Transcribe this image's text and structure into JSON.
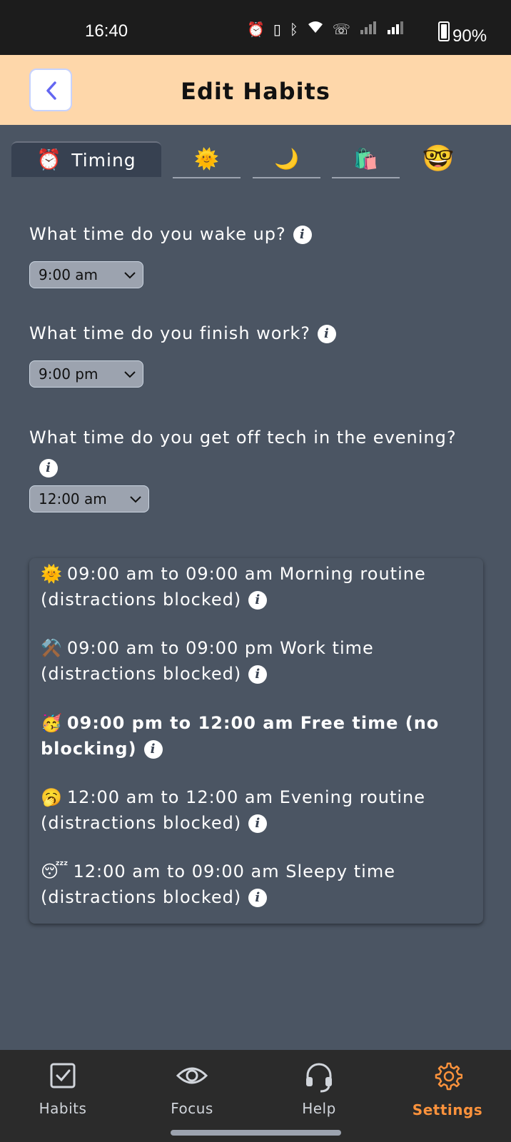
{
  "status_bar": {
    "time": "16:40",
    "battery": "90%",
    "icons": [
      "alarm-icon",
      "vibrate-icon",
      "bluetooth-icon",
      "wifi-icon",
      "wifi-calling-icon",
      "signal-1-icon",
      "signal-2-icon",
      "battery-icon"
    ]
  },
  "header": {
    "title": "Edit Habits",
    "back_icon": "chevron-left-icon"
  },
  "tabs": [
    {
      "emoji": "⏰",
      "label": "Timing",
      "active": true
    },
    {
      "emoji": "🌞",
      "label": "",
      "active": false
    },
    {
      "emoji": "🌙",
      "label": "",
      "active": false
    },
    {
      "emoji": "🛍️",
      "label": "",
      "active": false
    },
    {
      "emoji": "🤓",
      "label": "",
      "active": false
    }
  ],
  "questions": [
    {
      "text": "What time do you wake up?",
      "value": "9:00 am"
    },
    {
      "text": "What time do you finish work?",
      "value": "9:00 pm"
    },
    {
      "text": "What time do you get off tech in the evening?",
      "value": "12:00 am"
    }
  ],
  "schedule": [
    {
      "emoji": "🌞",
      "line1": "09:00 am to 09:00 am Morning routine",
      "line2": "(distractions blocked)",
      "bold": false
    },
    {
      "emoji": "⚒️",
      "line1": "09:00 am to 09:00 pm Work time",
      "line2": "(distractions blocked)",
      "bold": false
    },
    {
      "emoji": "🥳",
      "line1": "09:00 pm to 12:00 am Free time (no",
      "line2": "blocking)",
      "bold": true
    },
    {
      "emoji": "🥱",
      "line1": "12:00 am to 12:00 am Evening routine",
      "line2": "(distractions blocked)",
      "bold": false
    },
    {
      "emoji": "😴",
      "line1": "12:00 am to 09:00 am Sleepy time",
      "line2": "(distractions blocked)",
      "bold": false
    }
  ],
  "bottom_nav": [
    {
      "label": "Habits",
      "icon": "checkbox-icon",
      "active": false
    },
    {
      "label": "Focus",
      "icon": "eye-icon",
      "active": false
    },
    {
      "label": "Help",
      "icon": "headset-icon",
      "active": false
    },
    {
      "label": "Settings",
      "icon": "gear-icon",
      "active": true
    }
  ],
  "colors": {
    "header_bg": "#fed7aa",
    "page_bg": "#4b5563",
    "active_tab_bg": "#374151",
    "nav_active": "#fb923c",
    "back_chevron": "#6366f1"
  }
}
